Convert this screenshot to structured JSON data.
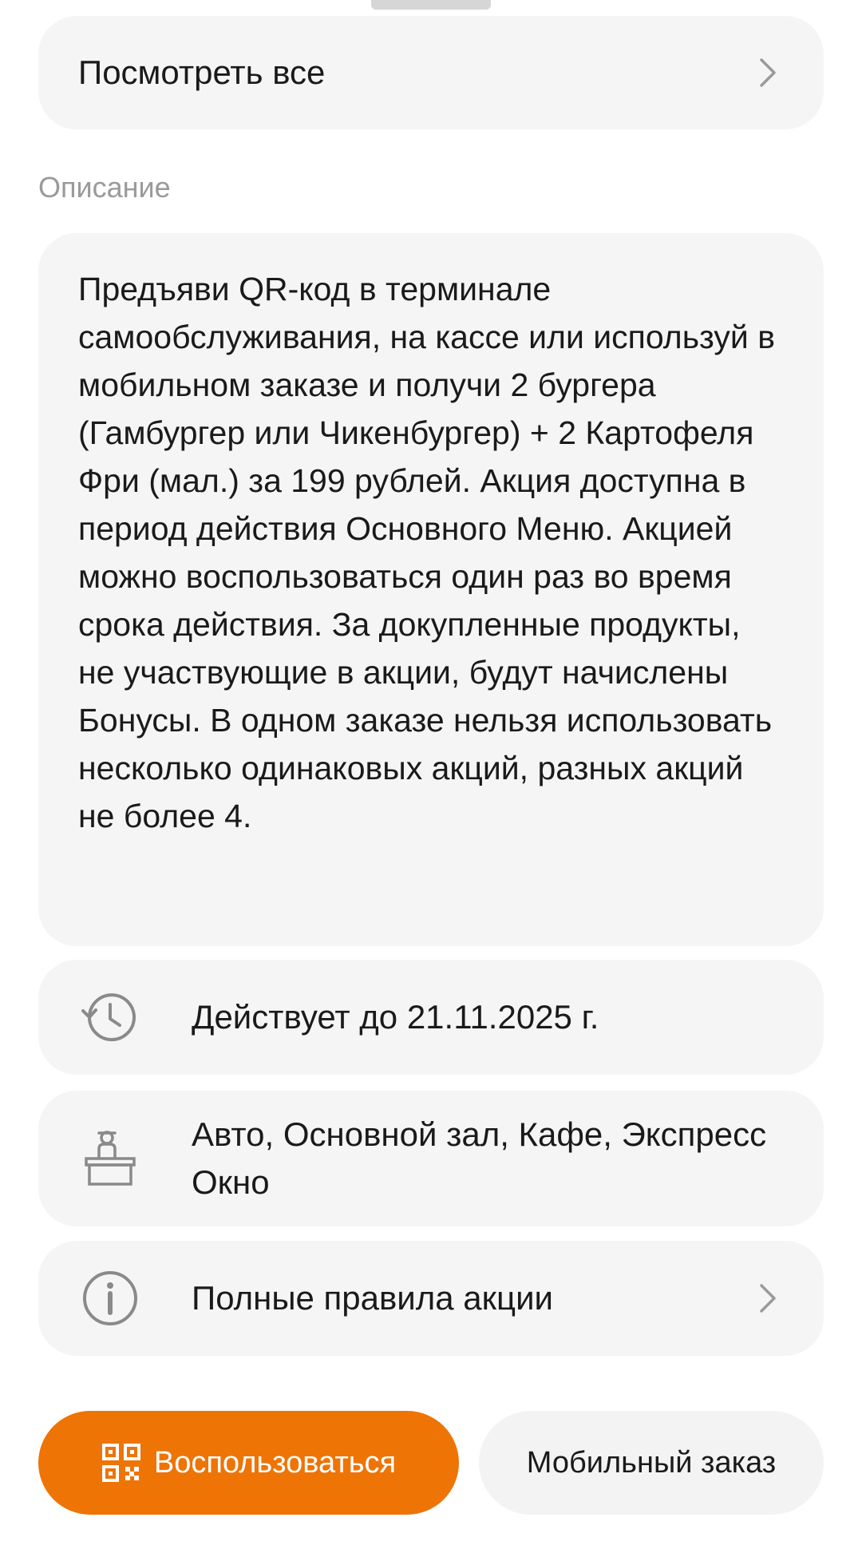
{
  "see_all": {
    "label": "Посмотреть все"
  },
  "description_section": {
    "title": "Описание",
    "text": "Предъяви QR-код в терминале самообслуживания, на кассе или используй в мобильном заказе и получи 2 бургера (Гамбургер или Чикенбургер) + 2 Картофеля Фри (мал.) за 199 рублей. Акция доступна в период действия Основного Меню. Акцией можно воспользоваться один раз во время срока действия. За докупленные продукты, не участвующие в акции, будут начислены Бонусы. В одном заказе нельзя использовать несколько одинаковых акций, разных акций не более 4."
  },
  "validity": {
    "icon": "history-clock-icon",
    "text": "Действует до 21.11.2025 г."
  },
  "places": {
    "icon": "cashier-counter-icon",
    "text": "Авто, Основной зал, Кафе, Экспресс Окно"
  },
  "rules": {
    "icon": "info-icon",
    "text": "Полные правила акции"
  },
  "buttons": {
    "use_label": "Воспользоваться",
    "mobile_order_label": "Мобильный заказ"
  },
  "colors": {
    "accent": "#ee7406",
    "card_bg": "#f5f5f5",
    "muted_text": "#9a9a9a"
  }
}
